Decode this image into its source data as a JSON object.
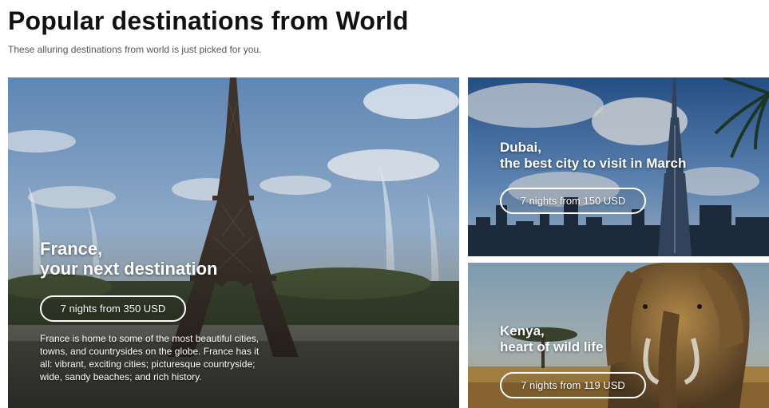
{
  "header": {
    "title": "Popular destinations from World",
    "subtitle": "These alluring destinations from world is just picked for you."
  },
  "destinations": [
    {
      "title": "France,\nyour next destination",
      "price_label": "7 nights from 350 USD",
      "description": "France is home to some of the most beautiful cities, towns, and countrysides on the globe. France has it all: vibrant, exciting cities; picturesque countryside; wide, sandy beaches; and rich history."
    },
    {
      "title": "Dubai,\nthe best city to visit in March",
      "price_label": "7 nights from 150 USD"
    },
    {
      "title": "Kenya,\nheart of wild life",
      "price_label": "7 nights from 119 USD"
    }
  ]
}
